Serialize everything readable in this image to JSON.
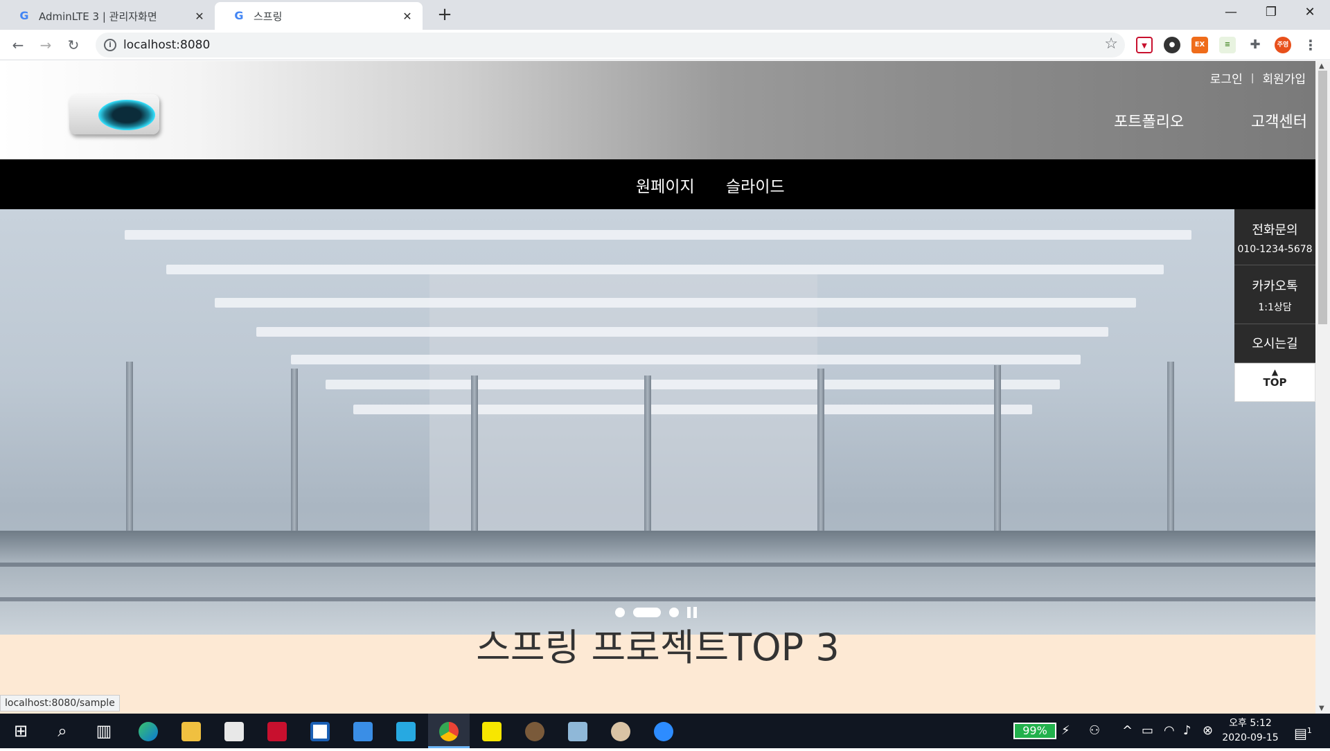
{
  "browser": {
    "tabs": [
      {
        "title": "AdminLTE 3 | 관리자화면",
        "active": false
      },
      {
        "title": "스프링",
        "active": true
      }
    ],
    "url": "localhost:8080",
    "status_url": "localhost:8080/sample"
  },
  "header": {
    "login": "로그인",
    "separator": "|",
    "signup": "회원가입",
    "menu": [
      "포트폴리오",
      "고객센터"
    ]
  },
  "nav": {
    "items": [
      "원페이지",
      "슬라이드"
    ]
  },
  "quick": {
    "phone_label": "전화문의",
    "phone_number": "010-1234-5678",
    "kakao_label": "카카오톡",
    "kakao_sub": "1:1상담",
    "directions": "오시는길",
    "top": "TOP"
  },
  "slider": {
    "count": 3,
    "active_index": 1
  },
  "section": {
    "title": "스프링 프로젝트TOP 3"
  },
  "taskbar": {
    "battery": "99%",
    "time": "오후 5:12",
    "date": "2020-09-15",
    "notifications": "1"
  },
  "colors": {
    "nav_bg": "#000000",
    "section_bg": "#fde9d4",
    "quick_bg": "#2b2b2b",
    "battery": "#22b14c"
  }
}
